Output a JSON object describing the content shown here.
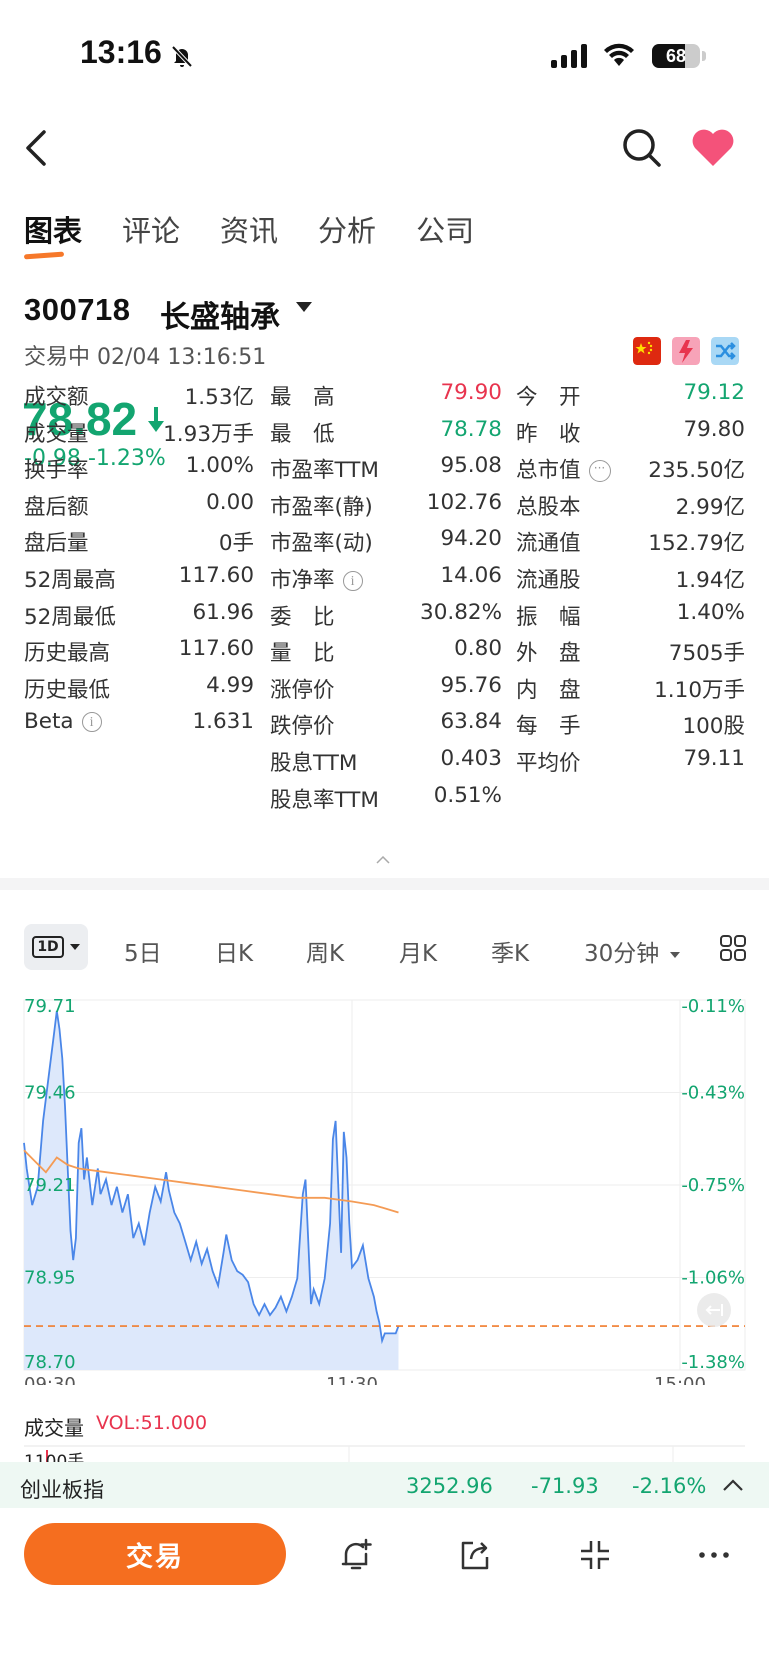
{
  "status_bar": {
    "time": "13:16",
    "battery": "68",
    "battery_level": 0.68
  },
  "nav": {
    "back_icon": "chevron-left-icon",
    "search_icon": "search-icon",
    "favorite_icon": "heart-icon"
  },
  "tabs": [
    {
      "label": "图表",
      "active": true
    },
    {
      "label": "评论",
      "active": false
    },
    {
      "label": "资讯",
      "active": false
    },
    {
      "label": "分析",
      "active": false
    },
    {
      "label": "公司",
      "active": false
    }
  ],
  "stock": {
    "code": "300718",
    "name": "长盛轴承",
    "status": "交易中 02/04 13:16:51",
    "price": "78.82",
    "change": "-0.98",
    "change_pct": "-1.23%",
    "colors": {
      "down": "#13a570",
      "up": "#e8344e",
      "accent": "#f56e1f"
    },
    "badges": [
      "cn-flag-icon",
      "margin-trading-icon",
      "connect-icon"
    ]
  },
  "quote": {
    "col1": [
      {
        "label": "成交额",
        "value": "1.53亿"
      },
      {
        "label": "成交量",
        "value": "1.93万手"
      },
      {
        "label": "换手率",
        "value": "1.00%"
      },
      {
        "label": "盘后额",
        "value": "0.00"
      },
      {
        "label": "盘后量",
        "value": "0手"
      },
      {
        "label": "52周最高",
        "value": "117.60"
      },
      {
        "label": "52周最低",
        "value": "61.96"
      },
      {
        "label": "历史最高",
        "value": "117.60"
      },
      {
        "label": "历史最低",
        "value": "4.99"
      },
      {
        "label": "Beta",
        "value": "1.631"
      }
    ],
    "col2": [
      {
        "label": "最　高",
        "value": "79.90"
      },
      {
        "label": "最　低",
        "value": "78.78"
      },
      {
        "label": "市盈率TTM",
        "value": "95.08"
      },
      {
        "label": "市盈率(静)",
        "value": "102.76"
      },
      {
        "label": "市盈率(动)",
        "value": "94.20"
      },
      {
        "label": "市净率",
        "value": "14.06"
      },
      {
        "label": "委　比",
        "value": "30.82%"
      },
      {
        "label": "量　比",
        "value": "0.80"
      },
      {
        "label": "涨停价",
        "value": "95.76"
      },
      {
        "label": "跌停价",
        "value": "63.84"
      },
      {
        "label": "股息TTM",
        "value": "0.403"
      },
      {
        "label": "股息率TTM",
        "value": "0.51%"
      }
    ],
    "col3": [
      {
        "label": "今　开",
        "value": "79.12"
      },
      {
        "label": "昨　收",
        "value": "79.80"
      },
      {
        "label": "总市值",
        "value": "235.50亿"
      },
      {
        "label": "总股本",
        "value": "2.99亿"
      },
      {
        "label": "流通值",
        "value": "152.79亿"
      },
      {
        "label": "流通股",
        "value": "1.94亿"
      },
      {
        "label": "振　幅",
        "value": "1.40%"
      },
      {
        "label": "外　盘",
        "value": "7505手"
      },
      {
        "label": "内　盘",
        "value": "1.10万手"
      },
      {
        "label": "每　手",
        "value": "100股"
      },
      {
        "label": "平均价",
        "value": "79.11"
      }
    ]
  },
  "period_tabs": {
    "selected": "1D",
    "items": [
      "5日",
      "日K",
      "周K",
      "月K",
      "季K",
      "30分钟"
    ],
    "more_icon": "grid-icon"
  },
  "chart_data": {
    "type": "line",
    "title": "",
    "x_labels": [
      "09:30",
      "11:30",
      "15:00"
    ],
    "y_left_ticks": [
      "79.71",
      "79.46",
      "79.21",
      "78.95",
      "78.70"
    ],
    "y_right_ticks": [
      "-0.11%",
      "-0.43%",
      "-0.75%",
      "-1.06%",
      "-1.38%"
    ],
    "ylim": [
      78.7,
      79.71
    ],
    "session_span_minutes": 240,
    "reference_price": 78.82,
    "series": [
      {
        "color": "#4a86e8",
        "points": [
          [
            0,
            79.32
          ],
          [
            1,
            79.25
          ],
          [
            3,
            79.15
          ],
          [
            5,
            79.2
          ],
          [
            7,
            79.38
          ],
          [
            9,
            79.5
          ],
          [
            11,
            79.62
          ],
          [
            12,
            79.68
          ],
          [
            13,
            79.63
          ],
          [
            14,
            79.55
          ],
          [
            15,
            79.42
          ],
          [
            16,
            79.25
          ],
          [
            17,
            79.08
          ],
          [
            18,
            79.0
          ],
          [
            19,
            79.06
          ],
          [
            20,
            79.32
          ],
          [
            21,
            79.36
          ],
          [
            22,
            79.22
          ],
          [
            23,
            79.28
          ],
          [
            25,
            79.15
          ],
          [
            27,
            79.25
          ],
          [
            28,
            79.18
          ],
          [
            30,
            79.22
          ],
          [
            32,
            79.15
          ],
          [
            34,
            79.2
          ],
          [
            36,
            79.13
          ],
          [
            38,
            79.18
          ],
          [
            40,
            79.06
          ],
          [
            42,
            79.1
          ],
          [
            44,
            79.04
          ],
          [
            46,
            79.13
          ],
          [
            48,
            79.2
          ],
          [
            50,
            79.16
          ],
          [
            52,
            79.24
          ],
          [
            53,
            79.19
          ],
          [
            55,
            79.13
          ],
          [
            57,
            79.1
          ],
          [
            59,
            79.05
          ],
          [
            61,
            79.0
          ],
          [
            63,
            79.05
          ],
          [
            65,
            78.99
          ],
          [
            67,
            79.03
          ],
          [
            69,
            78.97
          ],
          [
            71,
            78.93
          ],
          [
            73,
            79.02
          ],
          [
            74,
            79.07
          ],
          [
            76,
            79.0
          ],
          [
            78,
            78.97
          ],
          [
            80,
            78.96
          ],
          [
            82,
            78.94
          ],
          [
            84,
            78.88
          ],
          [
            86,
            78.85
          ],
          [
            88,
            78.88
          ],
          [
            90,
            78.85
          ],
          [
            92,
            78.87
          ],
          [
            94,
            78.9
          ],
          [
            96,
            78.86
          ],
          [
            98,
            78.9
          ],
          [
            100,
            78.95
          ],
          [
            102,
            79.18
          ],
          [
            103,
            79.22
          ],
          [
            104,
            79.05
          ],
          [
            105,
            78.88
          ],
          [
            106,
            78.92
          ],
          [
            108,
            78.88
          ],
          [
            110,
            78.95
          ],
          [
            112,
            79.1
          ],
          [
            113,
            79.33
          ],
          [
            114,
            79.38
          ],
          [
            115,
            79.2
          ],
          [
            116,
            79.02
          ],
          [
            117,
            79.35
          ],
          [
            118,
            79.28
          ],
          [
            119,
            79.1
          ],
          [
            120,
            78.98
          ],
          [
            122,
            79.0
          ],
          [
            124,
            79.04
          ],
          [
            126,
            78.95
          ],
          [
            128,
            78.9
          ],
          [
            129,
            78.86
          ],
          [
            130,
            78.83
          ],
          [
            131,
            78.78
          ],
          [
            132,
            78.8
          ],
          [
            134,
            78.8
          ],
          [
            136,
            78.8
          ],
          [
            137,
            78.82
          ]
        ]
      },
      {
        "color": "#f49b55",
        "points": [
          [
            0,
            79.3
          ],
          [
            4,
            79.27
          ],
          [
            8,
            79.24
          ],
          [
            12,
            79.28
          ],
          [
            16,
            79.26
          ],
          [
            20,
            79.25
          ],
          [
            30,
            79.24
          ],
          [
            40,
            79.23
          ],
          [
            50,
            79.22
          ],
          [
            60,
            79.21
          ],
          [
            70,
            79.2
          ],
          [
            80,
            79.19
          ],
          [
            90,
            79.18
          ],
          [
            100,
            79.17
          ],
          [
            110,
            79.17
          ],
          [
            120,
            79.16
          ],
          [
            128,
            79.15
          ],
          [
            137,
            79.13
          ]
        ]
      }
    ],
    "volume": {
      "label": "成交量",
      "value": "VOL:51.000",
      "axis_top": "1100手"
    }
  },
  "index_bar": {
    "name": "创业板指",
    "value": "3252.96",
    "change": "-71.93",
    "change_pct": "-2.16%"
  },
  "bottom": {
    "trade_label": "交易",
    "icons": [
      "add-alert-icon",
      "share-icon",
      "collapse-icon",
      "more-icon"
    ]
  }
}
